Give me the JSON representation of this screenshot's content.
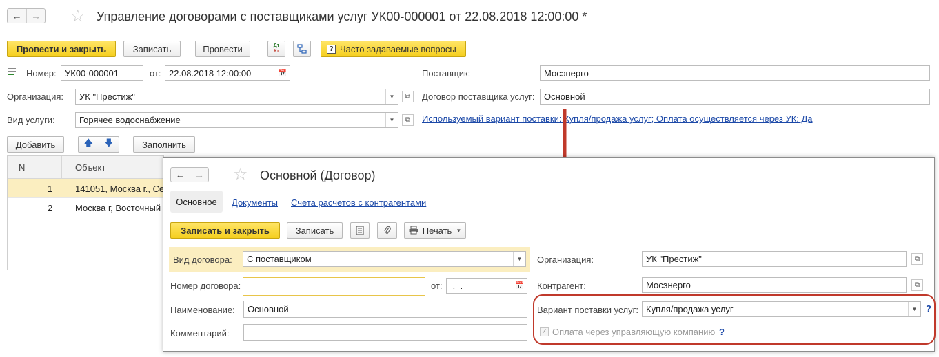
{
  "colors": {
    "accent_yellow": "#f5cf1e",
    "link_blue": "#1c49a8",
    "annotation_red": "#c0392b",
    "row_selected": "#fbeec0"
  },
  "main": {
    "title": "Управление договорами с поставщиками услуг УК00-000001 от 22.08.2018 12:00:00 *",
    "toolbar": {
      "post_close": "Провести и закрыть",
      "save": "Записать",
      "post": "Провести",
      "dtkt_icon_label": "ДТ КТ",
      "faq": "Часто задаваемые вопросы"
    },
    "form": {
      "number_label": "Номер:",
      "number_value": "УК00-000001",
      "date_label": "от:",
      "date_value": "22.08.2018 12:00:00",
      "org_label": "Организация:",
      "org_value": "УК \"Престиж\"",
      "service_label": "Вид услуги:",
      "service_value": "Горячее водоснабжение",
      "supplier_label": "Поставщик:",
      "supplier_value": "Мосэнерго",
      "contract_label": "Договор поставщика услуг:",
      "contract_value": "Основной",
      "delivery_link": "Используемый вариант поставки: Купля/продажа услуг; Оплата осуществляется через УК: Да"
    },
    "table_toolbar": {
      "add": "Добавить",
      "fill": "Заполнить"
    },
    "table": {
      "columns": [
        "N",
        "Объект"
      ],
      "rows": [
        {
          "n": "1",
          "object": "141051, Москва г., Се"
        },
        {
          "n": "2",
          "object": "Москва г, Восточный"
        }
      ]
    }
  },
  "popup": {
    "title": "Основной (Договор)",
    "tabs": [
      "Основное",
      "Документы",
      "Счета расчетов с контрагентами"
    ],
    "toolbar": {
      "save_close": "Записать и закрыть",
      "save": "Записать",
      "print": "Печать"
    },
    "form": {
      "kind_label": "Вид договора:",
      "kind_value": "С поставщиком",
      "number_label": "Номер договора:",
      "number_value": "",
      "date_label": "от:",
      "date_value": " .  .",
      "name_label": "Наименование:",
      "name_value": "Основной",
      "comment_label": "Комментарий:",
      "comment_value": "",
      "org_label": "Организация:",
      "org_value": "УК \"Престиж\"",
      "counterparty_label": "Контрагент:",
      "counterparty_value": "Мосэнерго",
      "variant_label": "Вариант поставки услуг:",
      "variant_value": "Купля/продажа услуг",
      "payment_label": "Оплата через управляющую компанию",
      "help_mark": "?"
    }
  }
}
